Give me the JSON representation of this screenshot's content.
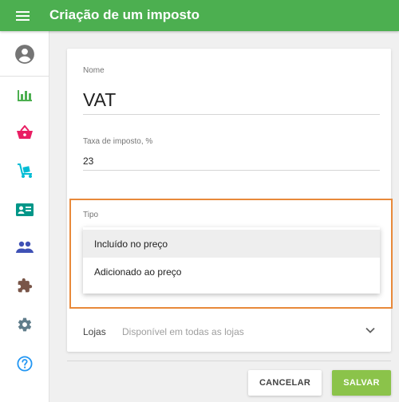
{
  "header": {
    "title": "Criação de um imposto",
    "menu_icon": "hamburger-menu-icon",
    "background": "#4caf50"
  },
  "sidebar": {
    "items": [
      {
        "icon": "account-circle-icon",
        "color": "#757575"
      },
      {
        "icon": "bar-chart-icon",
        "color": "#4caf50"
      },
      {
        "icon": "shopping-basket-icon",
        "color": "#e91e63"
      },
      {
        "icon": "dolly-cart-icon",
        "color": "#00bcd4"
      },
      {
        "icon": "contact-card-icon",
        "color": "#009688"
      },
      {
        "icon": "people-icon",
        "color": "#3f51b5"
      },
      {
        "icon": "puzzle-icon",
        "color": "#795548"
      },
      {
        "icon": "gear-icon",
        "color": "#607d8b"
      },
      {
        "icon": "help-icon",
        "color": "#2196f3"
      }
    ]
  },
  "form": {
    "name": {
      "label": "Nome",
      "value": "VAT"
    },
    "tax_rate": {
      "label": "Taxa de imposto, %",
      "value": "23"
    },
    "type": {
      "label": "Tipo",
      "options": [
        "Incluído no preço",
        "Adicionado ao preço"
      ],
      "highlighted_option": "Incluído no preço"
    },
    "stores": {
      "label": "Lojas",
      "value": "Disponível em todas as lojas"
    }
  },
  "actions": {
    "cancel_label": "CANCELAR",
    "save_label": "SALVAR"
  },
  "colors": {
    "accent": "#4caf50",
    "save_button": "#8bc34a",
    "highlight_border": "#e8893a"
  }
}
